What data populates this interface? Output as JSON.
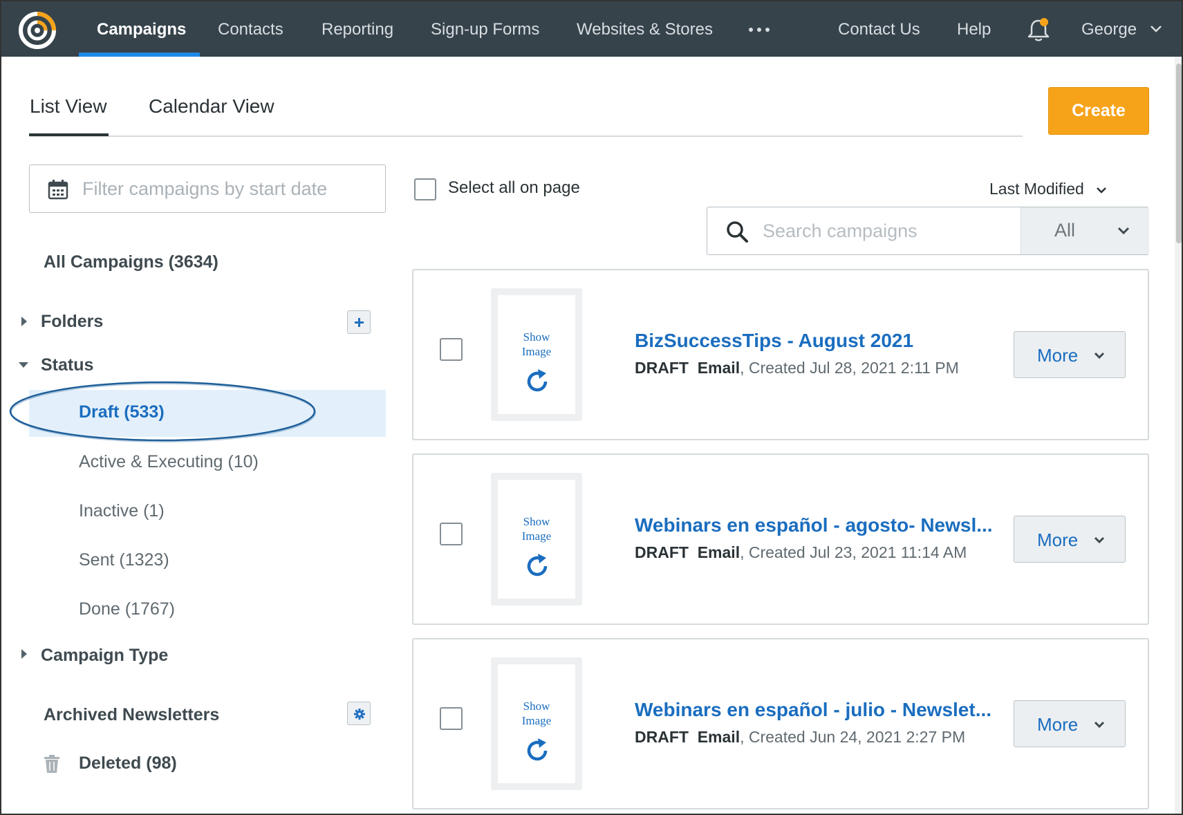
{
  "nav": {
    "items": [
      "Campaigns",
      "Contacts",
      "Reporting",
      "Sign-up Forms",
      "Websites & Stores"
    ],
    "contact": "Contact Us",
    "help": "Help",
    "user": "George",
    "accent": "#1f8ae6",
    "notification_dot": "#f7a31a"
  },
  "views": {
    "list": "List View",
    "calendar": "Calendar View"
  },
  "create_label": "Create",
  "sidebar": {
    "date_placeholder": "Filter campaigns by start date",
    "all_campaigns": "All Campaigns (3634)",
    "folders": "Folders",
    "status": "Status",
    "status_items": [
      "Draft (533)",
      "Active & Executing (10)",
      "Inactive (1)",
      "Sent (1323)",
      "Done (1767)"
    ],
    "campaign_type": "Campaign Type",
    "archived": "Archived Newsletters",
    "deleted": "Deleted (98)"
  },
  "list": {
    "select_all": "Select all on page",
    "sort": "Last Modified",
    "search_placeholder": "Search campaigns",
    "type_filter": "All",
    "more_label": "More",
    "thumb_text": [
      "Show",
      "Image"
    ],
    "campaigns": [
      {
        "title": "BizSuccessTips - August 2021",
        "status": "DRAFT",
        "type": "Email",
        "created": ", Created Jul 28, 2021 2:11 PM"
      },
      {
        "title": "Webinars en español - agosto- Newsl...",
        "status": "DRAFT",
        "type": "Email",
        "created": ", Created Jul 23, 2021 11:14 AM"
      },
      {
        "title": "Webinars en español - julio - Newslet...",
        "status": "DRAFT",
        "type": "Email",
        "created": ", Created Jun 24, 2021 2:27 PM"
      }
    ]
  }
}
